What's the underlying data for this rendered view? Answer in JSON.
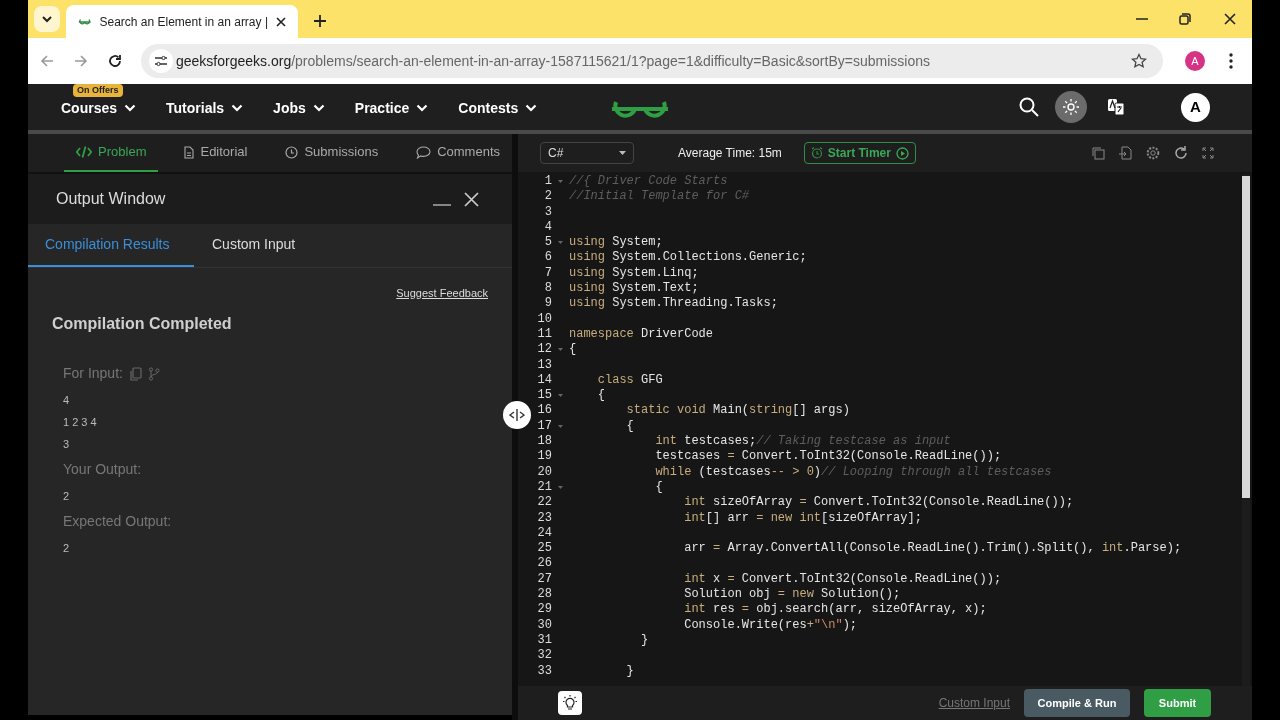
{
  "browser": {
    "tab_title": "Search an Element in an array |",
    "url_domain": "geeksforgeeks.org",
    "url_path": "/problems/search-an-element-in-an-array-1587115621/1?page=1&difficulty=Basic&sortBy=submissions",
    "profile": "A"
  },
  "nav": {
    "items": [
      {
        "label": "Courses",
        "badge": "On Offers"
      },
      {
        "label": "Tutorials"
      },
      {
        "label": "Jobs"
      },
      {
        "label": "Practice"
      },
      {
        "label": "Contests"
      }
    ],
    "avatar": "A"
  },
  "problem_tabs": [
    {
      "label": "Problem",
      "selected": true
    },
    {
      "label": "Editorial",
      "selected": false
    },
    {
      "label": "Submissions",
      "selected": false
    },
    {
      "label": "Comments",
      "selected": false
    }
  ],
  "output_window": {
    "title": "Output Window",
    "tabs": [
      {
        "label": "Compilation Results",
        "selected": true
      },
      {
        "label": "Custom Input",
        "selected": false
      }
    ],
    "feedback_link": "Suggest Feedback",
    "status": "Compilation Completed",
    "sections": [
      {
        "label": "For Input:",
        "actions": true,
        "lines": [
          "4",
          "1 2 3 4",
          "3"
        ]
      },
      {
        "label": "Your Output:",
        "actions": false,
        "lines": [
          "2"
        ]
      },
      {
        "label": "Expected Output:",
        "actions": false,
        "lines": [
          "2"
        ]
      }
    ]
  },
  "editor": {
    "language": "C#",
    "average_time": "Average Time: 15m",
    "timer_button": "Start Timer",
    "lines": [
      {
        "number": "1",
        "fold": true,
        "tokens": [
          {
            "kind": "comment",
            "text": "//{ Driver Code Starts"
          }
        ]
      },
      {
        "number": "2",
        "fold": false,
        "tokens": [
          {
            "kind": "comment",
            "text": "//Initial Template for C#"
          }
        ]
      },
      {
        "number": "3",
        "fold": false
      },
      {
        "number": "4",
        "fold": false
      },
      {
        "number": "5",
        "fold": true,
        "tokens": [
          {
            "kind": "keyword",
            "text": "using"
          },
          {
            "kind": "plain",
            "text": " System;"
          }
        ]
      },
      {
        "number": "6",
        "fold": false,
        "tokens": [
          {
            "kind": "keyword",
            "text": "using"
          },
          {
            "kind": "plain",
            "text": " System.Collections.Generic;"
          }
        ]
      },
      {
        "number": "7",
        "fold": false,
        "tokens": [
          {
            "kind": "keyword",
            "text": "using"
          },
          {
            "kind": "plain",
            "text": " System.Linq;"
          }
        ]
      },
      {
        "number": "8",
        "fold": false,
        "tokens": [
          {
            "kind": "keyword",
            "text": "using"
          },
          {
            "kind": "plain",
            "text": " System.Text;"
          }
        ]
      },
      {
        "number": "9",
        "fold": false,
        "tokens": [
          {
            "kind": "keyword",
            "text": "using"
          },
          {
            "kind": "plain",
            "text": " System.Threading.Tasks;"
          }
        ]
      },
      {
        "number": "10",
        "fold": false
      },
      {
        "number": "11",
        "fold": false,
        "tokens": [
          {
            "kind": "keyword",
            "text": "namespace"
          },
          {
            "kind": "plain",
            "text": " DriverCode"
          }
        ]
      },
      {
        "number": "12",
        "fold": true,
        "tokens": [
          {
            "kind": "plain",
            "text": "{"
          }
        ]
      },
      {
        "number": "13",
        "fold": false
      },
      {
        "number": "14",
        "fold": false,
        "tokens": [
          {
            "kind": "keyword",
            "text": "    class"
          },
          {
            "kind": "plain",
            "text": " GFG"
          }
        ]
      },
      {
        "number": "15",
        "fold": true,
        "tokens": [
          {
            "kind": "plain",
            "text": "    {"
          }
        ]
      },
      {
        "number": "16",
        "fold": false,
        "tokens": [
          {
            "kind": "keyword",
            "text": "        static void"
          },
          {
            "kind": "plain",
            "text": " Main("
          },
          {
            "kind": "keyword",
            "text": "string"
          },
          {
            "kind": "plain",
            "text": "[] args)"
          }
        ]
      },
      {
        "number": "17",
        "fold": true,
        "tokens": [
          {
            "kind": "plain",
            "text": "        {"
          }
        ]
      },
      {
        "number": "18",
        "fold": false,
        "tokens": [
          {
            "kind": "keyword",
            "text": "            int"
          },
          {
            "kind": "plain",
            "text": " testcases;"
          },
          {
            "kind": "comment",
            "text": "// Taking testcase as input"
          }
        ]
      },
      {
        "number": "19",
        "fold": false,
        "tokens": [
          {
            "kind": "plain",
            "text": "            testcases "
          },
          {
            "kind": "keyword",
            "text": "="
          },
          {
            "kind": "plain",
            "text": " Convert.ToInt32(Console.ReadLine());"
          }
        ]
      },
      {
        "number": "20",
        "fold": false,
        "tokens": [
          {
            "kind": "keyword",
            "text": "            while"
          },
          {
            "kind": "plain",
            "text": " (testcases"
          },
          {
            "kind": "keyword",
            "text": "-- > 0"
          },
          {
            "kind": "plain",
            "text": ")"
          },
          {
            "kind": "comment",
            "text": "// Looping through all testcases"
          }
        ]
      },
      {
        "number": "21",
        "fold": true,
        "tokens": [
          {
            "kind": "plain",
            "text": "            {"
          }
        ]
      },
      {
        "number": "22",
        "fold": false,
        "tokens": [
          {
            "kind": "keyword",
            "text": "                int"
          },
          {
            "kind": "plain",
            "text": " sizeOfArray "
          },
          {
            "kind": "keyword",
            "text": "="
          },
          {
            "kind": "plain",
            "text": " Convert.ToInt32(Console.ReadLine());"
          }
        ]
      },
      {
        "number": "23",
        "fold": false,
        "tokens": [
          {
            "kind": "keyword",
            "text": "                int"
          },
          {
            "kind": "plain",
            "text": "[] arr "
          },
          {
            "kind": "keyword",
            "text": "= new int"
          },
          {
            "kind": "plain",
            "text": "[sizeOfArray];"
          }
        ]
      },
      {
        "number": "24",
        "fold": false
      },
      {
        "number": "25",
        "fold": false,
        "tokens": [
          {
            "kind": "plain",
            "text": "                arr "
          },
          {
            "kind": "keyword",
            "text": "="
          },
          {
            "kind": "plain",
            "text": " Array.ConvertAll(Console.ReadLine().Trim().Split(), "
          },
          {
            "kind": "keyword",
            "text": "int"
          },
          {
            "kind": "plain",
            "text": ".Parse);"
          }
        ]
      },
      {
        "number": "26",
        "fold": false
      },
      {
        "number": "27",
        "fold": false,
        "tokens": [
          {
            "kind": "keyword",
            "text": "                int"
          },
          {
            "kind": "plain",
            "text": " x "
          },
          {
            "kind": "keyword",
            "text": "="
          },
          {
            "kind": "plain",
            "text": " Convert.ToInt32(Console.ReadLine());"
          }
        ]
      },
      {
        "number": "28",
        "fold": false,
        "tokens": [
          {
            "kind": "plain",
            "text": "                Solution obj "
          },
          {
            "kind": "keyword",
            "text": "= new"
          },
          {
            "kind": "plain",
            "text": " Solution();"
          }
        ]
      },
      {
        "number": "29",
        "fold": false,
        "tokens": [
          {
            "kind": "keyword",
            "text": "                int"
          },
          {
            "kind": "plain",
            "text": " res "
          },
          {
            "kind": "keyword",
            "text": "="
          },
          {
            "kind": "plain",
            "text": " obj.search(arr, sizeOfArray, x);"
          }
        ]
      },
      {
        "number": "30",
        "fold": false,
        "tokens": [
          {
            "kind": "plain",
            "text": "                Console.Write(res"
          },
          {
            "kind": "keyword",
            "text": "+"
          },
          {
            "kind": "string",
            "text": "\"\\n\""
          },
          {
            "kind": "plain",
            "text": ");"
          }
        ]
      },
      {
        "number": "31",
        "fold": false,
        "tokens": [
          {
            "kind": "plain",
            "text": "          }"
          }
        ]
      },
      {
        "number": "32",
        "fold": false
      },
      {
        "number": "33",
        "fold": false,
        "tokens": [
          {
            "kind": "plain",
            "text": "        }"
          }
        ]
      }
    ]
  },
  "footer": {
    "custom_input": "Custom Input",
    "compile_button": "Compile & Run",
    "submit_button": "Submit"
  }
}
